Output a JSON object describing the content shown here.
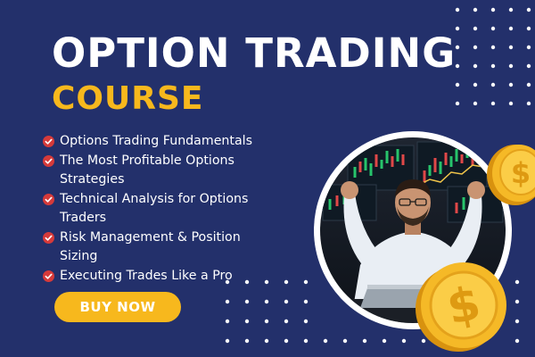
{
  "title": "OPTION TRADING",
  "subtitle": "COURSE",
  "features": [
    {
      "line1": "Options Trading Fundamentals",
      "line2": ""
    },
    {
      "line1": "The Most Profitable Options",
      "line2": "Strategies"
    },
    {
      "line1": "Technical Analysis for Options",
      "line2": "Traders"
    },
    {
      "line1": "Risk Management & Position",
      "line2": "Sizing"
    },
    {
      "line1": "Executing Trades Like a Pro",
      "line2": ""
    }
  ],
  "cta_label": "BUY NOW",
  "coin_symbol": "$",
  "colors": {
    "background": "#23306b",
    "accent": "#f7b81d",
    "check": "#d63a3a",
    "text": "#ffffff"
  }
}
